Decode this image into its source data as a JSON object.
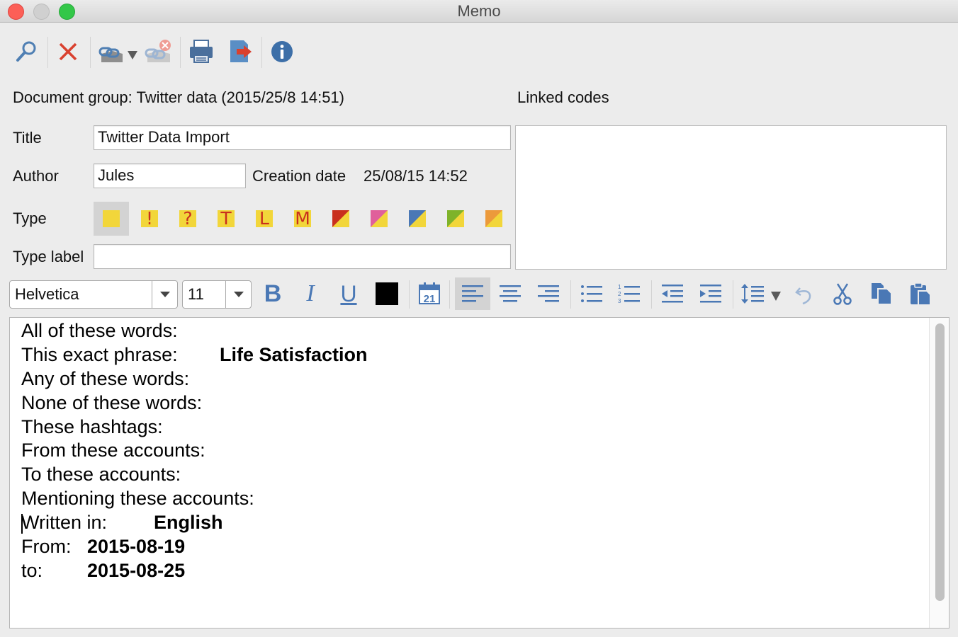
{
  "window": {
    "title": "Memo"
  },
  "toolbar": {
    "items": [
      "search-icon",
      "delete-icon",
      "link-code-icon",
      "unlink-code-icon",
      "print-icon",
      "export-icon",
      "info-icon"
    ]
  },
  "header": {
    "document_group": "Document group: Twitter data (2015/25/8 14:51)",
    "linked_codes_label": "Linked codes"
  },
  "form": {
    "title_label": "Title",
    "title_value": "Twitter Data Import",
    "author_label": "Author",
    "author_value": "Jules",
    "creation_label": "Creation date",
    "creation_value": "25/08/15 14:52",
    "type_label": "Type",
    "type_label_label": "Type label",
    "type_label_value": ""
  },
  "memo_types": [
    {
      "glyph": "",
      "color": "#f2d63a",
      "corner": "",
      "selected": true
    },
    {
      "glyph": "!",
      "color": "#f2d63a",
      "corner": ""
    },
    {
      "glyph": "?",
      "color": "#f2d63a",
      "corner": ""
    },
    {
      "glyph": "T",
      "color": "#f2d63a",
      "corner": ""
    },
    {
      "glyph": "L",
      "color": "#f2d63a",
      "corner": ""
    },
    {
      "glyph": "M",
      "color": "#f2d63a",
      "corner": ""
    },
    {
      "glyph": "",
      "color": "#f2d63a",
      "corner": "#c9301e"
    },
    {
      "glyph": "",
      "color": "#f2d63a",
      "corner": "#e0609b"
    },
    {
      "glyph": "",
      "color": "#f2d63a",
      "corner": "#4a78b5"
    },
    {
      "glyph": "",
      "color": "#f2d63a",
      "corner": "#7fb32a"
    },
    {
      "glyph": "",
      "color": "#f2d63a",
      "corner": "#ec9a3b"
    }
  ],
  "format": {
    "font": "Helvetica",
    "size": "11",
    "bold": "B",
    "italic": "I",
    "underline": "U",
    "calendar_day": "21",
    "text_color": "#000000",
    "alignment": "left"
  },
  "memo_text": [
    {
      "label": "All of these words:",
      "value": ""
    },
    {
      "label": "This exact phrase:",
      "value": "Life Satisfaction"
    },
    {
      "label": "Any of these words:",
      "value": ""
    },
    {
      "label": "None of  these words:",
      "value": ""
    },
    {
      "label": "These hashtags:",
      "value": ""
    },
    {
      "label": "From these accounts:",
      "value": ""
    },
    {
      "label": "To these accounts:",
      "value": ""
    },
    {
      "label": "Mentioning these accounts:",
      "value": ""
    },
    {
      "label": "Written in:",
      "value": "English"
    },
    {
      "label": "From:",
      "value": "2015-08-19"
    },
    {
      "label": "to:",
      "value": "2015-08-25"
    }
  ]
}
